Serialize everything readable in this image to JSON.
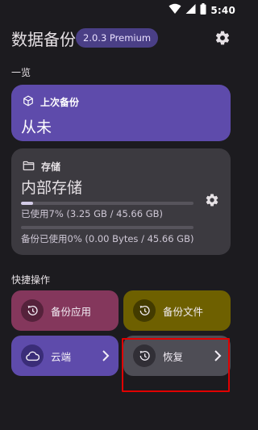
{
  "status_bar": {
    "time": "5:40",
    "icons": [
      "wifi-icon",
      "cellular-signal-icon",
      "battery-icon"
    ]
  },
  "header": {
    "title": "数据备份",
    "version_badge": "2.0.3 Premium",
    "settings_icon": "gear-icon"
  },
  "overview": {
    "section_label": "一览",
    "last_backup": {
      "caption": "上次备份",
      "value": "从未",
      "icon": "cube-icon"
    },
    "storage": {
      "caption": "存储",
      "location": "内部存储",
      "icon": "folder-icon",
      "settings_icon": "gear-icon",
      "used_percent": 7,
      "used_text": "已使用7% (3.25 GB / 45.66 GB)",
      "backup_used_percent": 0,
      "backup_used_text": "备份已使用0% (0.00 Bytes / 45.66 GB)"
    }
  },
  "quick_actions": {
    "section_label": "快捷操作",
    "items": [
      {
        "label": "备份应用",
        "icon": "history-icon",
        "chevron": false
      },
      {
        "label": "备份文件",
        "icon": "history-icon",
        "chevron": false
      },
      {
        "label": "云端",
        "icon": "cloud-icon",
        "chevron": true
      },
      {
        "label": "恢复",
        "icon": "restore-icon",
        "chevron": true
      }
    ]
  },
  "colors": {
    "background": "#1c1b1f",
    "accent_purple": "#5e4bab",
    "storage_card": "#3c3a40",
    "backup_apps": "#84375c",
    "backup_files": "#6e6000",
    "restore": "#4e4d55",
    "highlight": "#e00000"
  }
}
